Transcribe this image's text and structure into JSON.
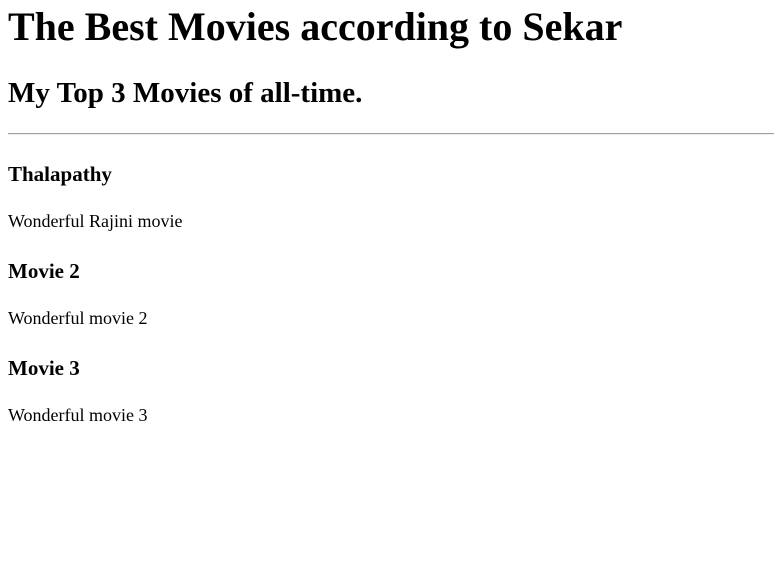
{
  "page": {
    "title": "The Best Movies according to Sekar",
    "subtitle": "My Top 3 Movies of all-time."
  },
  "movies": [
    {
      "title": "Thalapathy",
      "description": "Wonderful Rajini movie"
    },
    {
      "title": "Movie 2",
      "description": "Wonderful movie 2"
    },
    {
      "title": "Movie 3",
      "description": "Wonderful movie 3"
    }
  ]
}
